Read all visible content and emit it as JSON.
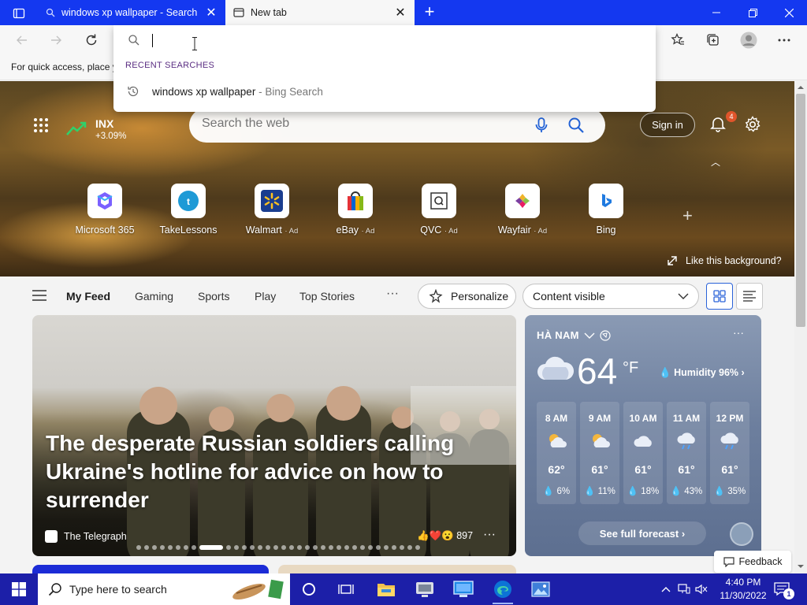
{
  "browser": {
    "tabs": [
      {
        "title": "windows xp wallpaper - Search (",
        "active": false
      },
      {
        "title": "New tab",
        "active": true
      }
    ],
    "tabstrip_color": "#1438f0"
  },
  "address_dropdown": {
    "input_value": "",
    "recent_header": "RECENT SEARCHES",
    "recent_items": [
      {
        "query": "windows xp wallpaper",
        "source": " - Bing Search"
      }
    ]
  },
  "favorites_bar": {
    "hint": "For quick access, place y"
  },
  "hero": {
    "stock": {
      "name": "INX",
      "change": "+3.09%"
    },
    "search_placeholder": "Search the web",
    "signin_label": "Sign in",
    "notifications_count": "4",
    "tiles": [
      {
        "label": "Microsoft 365",
        "ad": ""
      },
      {
        "label": "TakeLessons",
        "ad": ""
      },
      {
        "label": "Walmart",
        "ad": "· Ad"
      },
      {
        "label": "eBay",
        "ad": "· Ad"
      },
      {
        "label": "QVC",
        "ad": "· Ad"
      },
      {
        "label": "Wayfair",
        "ad": "· Ad"
      },
      {
        "label": "Bing",
        "ad": ""
      }
    ],
    "like_background": "Like this background?"
  },
  "feed_nav": {
    "items": [
      "My Feed",
      "Gaming",
      "Sports",
      "Play",
      "Top Stories"
    ],
    "more": "···",
    "personalize": "Personalize",
    "content_visible": "Content visible"
  },
  "story": {
    "headline": "The desperate Russian soldiers calling Ukraine's hotline for advice on how to surrender",
    "source": "The Telegraph",
    "reactions": "897",
    "menu": "···"
  },
  "weather": {
    "location": "HÀ NAM",
    "temperature": "64",
    "unit": "°F",
    "humidity": "Humidity 96%",
    "hours": [
      {
        "time": "8 AM",
        "temp": "62°",
        "precip": "6%"
      },
      {
        "time": "9 AM",
        "temp": "61°",
        "precip": "11%"
      },
      {
        "time": "10 AM",
        "temp": "61°",
        "precip": "18%"
      },
      {
        "time": "11 AM",
        "temp": "61°",
        "precip": "43%"
      },
      {
        "time": "12 PM",
        "temp": "61°",
        "precip": "35%"
      }
    ],
    "forecast_label": "See full forecast",
    "menu": "···"
  },
  "feedback_label": "Feedback",
  "taskbar": {
    "search_placeholder": "Type here to search",
    "time": "4:40 PM",
    "date": "11/30/2022",
    "notification_count": "1"
  }
}
